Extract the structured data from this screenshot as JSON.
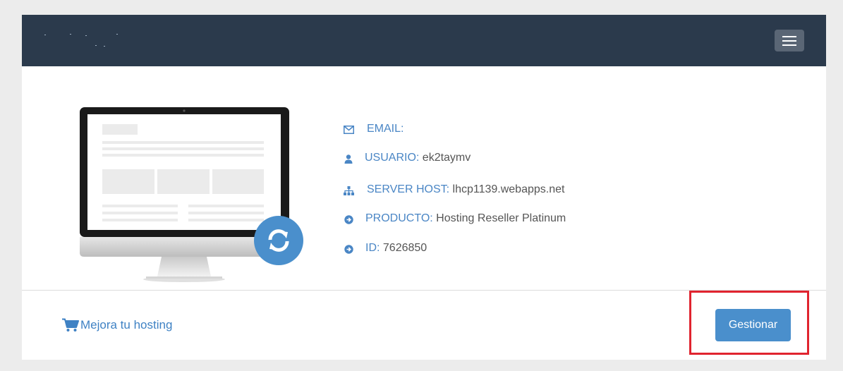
{
  "header": {
    "logo_icon": "logo-placeholder",
    "menu_icon": "hamburger-icon",
    "background": "#2b3a4c"
  },
  "details": {
    "email": {
      "label": "EMAIL:",
      "value": "",
      "icon": "envelope-icon"
    },
    "user": {
      "label": "USUARIO:",
      "value": " ek2taymv",
      "icon": "user-icon"
    },
    "server": {
      "label": "SERVER HOST:",
      "value": " lhcp1139.webapps.net",
      "icon": "sitemap-icon"
    },
    "product": {
      "label": "PRODUCTO:",
      "value": " Hosting Reseller Platinum",
      "icon": "arrow-circle-right-icon"
    },
    "id": {
      "label": "ID:",
      "value": " 7626850",
      "icon": "arrow-circle-right-icon"
    }
  },
  "footer": {
    "upgrade_label": "Mejora tu hosting",
    "upgrade_icon": "shopping-cart-icon",
    "manage_label": "Gestionar"
  },
  "colors": {
    "accent": "#4a8fcc",
    "link": "#3f82c4",
    "highlight": "#e0242f"
  }
}
